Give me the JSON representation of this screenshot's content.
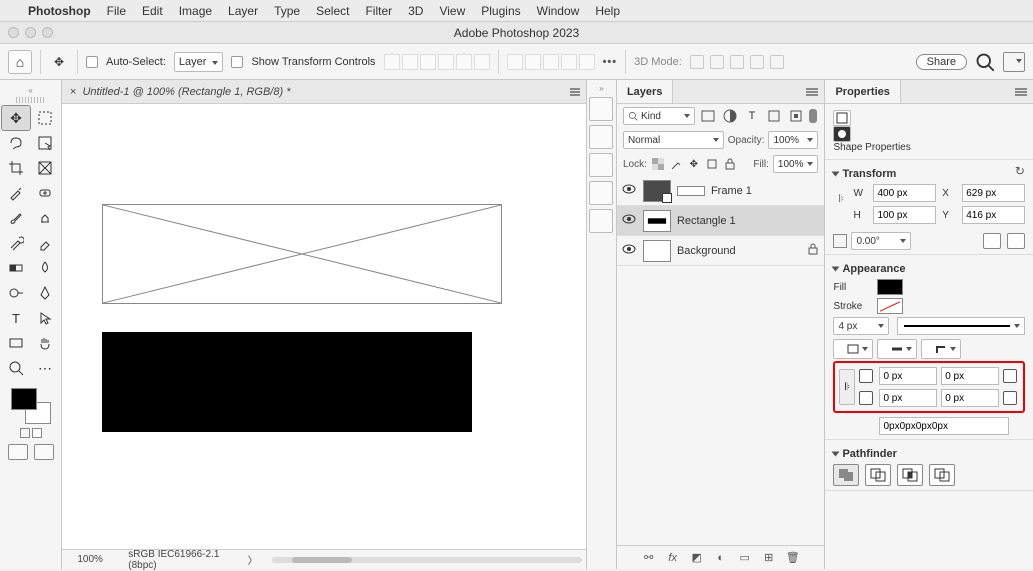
{
  "menubar": {
    "app": "Photoshop",
    "items": [
      "File",
      "Edit",
      "Image",
      "Layer",
      "Type",
      "Select",
      "Filter",
      "3D",
      "View",
      "Plugins",
      "Window",
      "Help"
    ]
  },
  "window_title": "Adobe Photoshop 2023",
  "optionbar": {
    "auto_select": "Auto-Select:",
    "layer_dd": "Layer",
    "show_tc": "Show Transform Controls",
    "threeD": "3D Mode:",
    "share": "Share"
  },
  "doc_tab": "Untitled-1 @ 100% (Rectangle 1, RGB/8) *",
  "status": {
    "zoom": "100%",
    "profile": "sRGB IEC61966-2.1 (8bpc)"
  },
  "layers_panel": {
    "title": "Layers",
    "kind": "Kind",
    "blend": "Normal",
    "opacity_lbl": "Opacity:",
    "opacity": "100%",
    "lock_lbl": "Lock:",
    "fill_lbl": "Fill:",
    "fill": "100%",
    "items": [
      {
        "name": "Frame 1"
      },
      {
        "name": "Rectangle 1"
      },
      {
        "name": "Background"
      }
    ]
  },
  "properties": {
    "title": "Properties",
    "shape_header": "Shape Properties",
    "transform": {
      "title": "Transform",
      "W": "400 px",
      "X": "629 px",
      "H": "100 px",
      "Y": "416 px",
      "angle": "0.00°"
    },
    "appearance": {
      "title": "Appearance",
      "fill": "Fill",
      "stroke": "Stroke",
      "stroke_w": "4 px"
    },
    "corners": {
      "tl": "0 px",
      "tr": "0 px",
      "bl": "0 px",
      "br": "0 px",
      "summary": "0px0px0px0px"
    },
    "pathfinder": "Pathfinder",
    "labels": {
      "W": "W",
      "H": "H",
      "X": "X",
      "Y": "Y"
    }
  }
}
